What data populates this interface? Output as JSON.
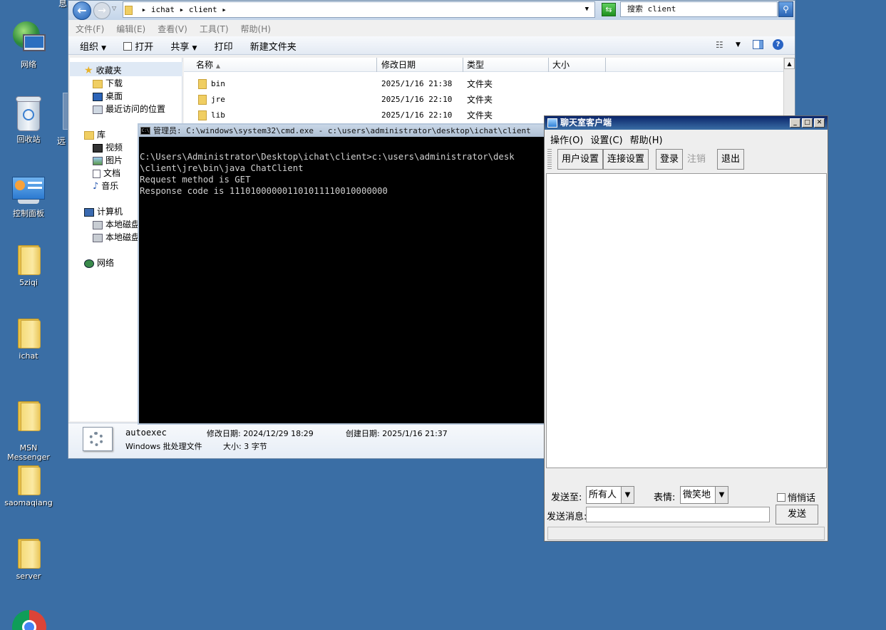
{
  "desktop": {
    "icons": [
      {
        "name": "network-icon",
        "label": "网络"
      },
      {
        "name": "recycle-bin-icon",
        "label": "回收站"
      },
      {
        "name": "control-panel-icon",
        "label": "控制面板"
      },
      {
        "name": "folder-icon",
        "label": "5ziqi"
      },
      {
        "name": "folder-icon",
        "label": "ichat"
      },
      {
        "name": "folder-icon",
        "label": "MSN\nMessenger"
      },
      {
        "name": "folder-icon",
        "label": "saomaqiang"
      },
      {
        "name": "folder-icon",
        "label": "server"
      }
    ],
    "partial_label_1": "远",
    "partial_label_2": "息"
  },
  "explorer": {
    "breadcrumb": [
      "ichat",
      "client"
    ],
    "search_placeholder": "搜索 client",
    "menu": [
      "文件(F)",
      "编辑(E)",
      "查看(V)",
      "工具(T)",
      "帮助(H)"
    ],
    "toolbar": {
      "organize": "组织",
      "open": "打开",
      "share": "共享",
      "print": "打印",
      "new_folder": "新建文件夹"
    },
    "nav": {
      "favorites": "收藏夹",
      "downloads": "下载",
      "desktop": "桌面",
      "recent": "最近访问的位置",
      "libraries": "库",
      "videos": "视频",
      "pictures": "图片",
      "documents": "文档",
      "music": "音乐",
      "computer": "计算机",
      "local_disk_1": "本地磁盘",
      "local_disk_2": "本地磁盘",
      "network": "网络"
    },
    "columns": {
      "name": "名称",
      "date": "修改日期",
      "type": "类型",
      "size": "大小"
    },
    "files": [
      {
        "name": "bin",
        "date": "2025/1/16 21:38",
        "type": "文件夹"
      },
      {
        "name": "jre",
        "date": "2025/1/16 22:10",
        "type": "文件夹"
      },
      {
        "name": "lib",
        "date": "2025/1/16 22:10",
        "type": "文件夹"
      }
    ],
    "details": {
      "filename": "autoexec",
      "modified": "修改日期: 2024/12/29 18:29",
      "created": "创建日期: 2025/1/16 21:37",
      "filetype": "Windows 批处理文件",
      "size": "大小: 3 字节"
    }
  },
  "cmd": {
    "title": "管理员: C:\\windows\\system32\\cmd.exe - c:\\users\\administrator\\desktop\\ichat\\client",
    "output": "C:\\Users\\Administrator\\Desktop\\ichat\\client>c:\\users\\administrator\\desk\n\\client\\jre\\bin\\java ChatClient\nRequest method is GET\nResponse code is 111010000001101011110010000000"
  },
  "chat": {
    "title": "聊天室客户端",
    "menu": [
      "操作(O)",
      "设置(C)",
      "帮助(H)"
    ],
    "buttons": {
      "user_settings": "用户设置",
      "connection_settings": "连接设置",
      "login": "登录",
      "logout": "注销",
      "exit": "退出"
    },
    "send_to_label": "发送至:",
    "send_to_value": "所有人",
    "emotion_label": "表情:",
    "emotion_value": "微笑地",
    "whisper_label": "悄悄话",
    "message_label": "发送消息:",
    "message_value": "",
    "send_button": "发送"
  }
}
